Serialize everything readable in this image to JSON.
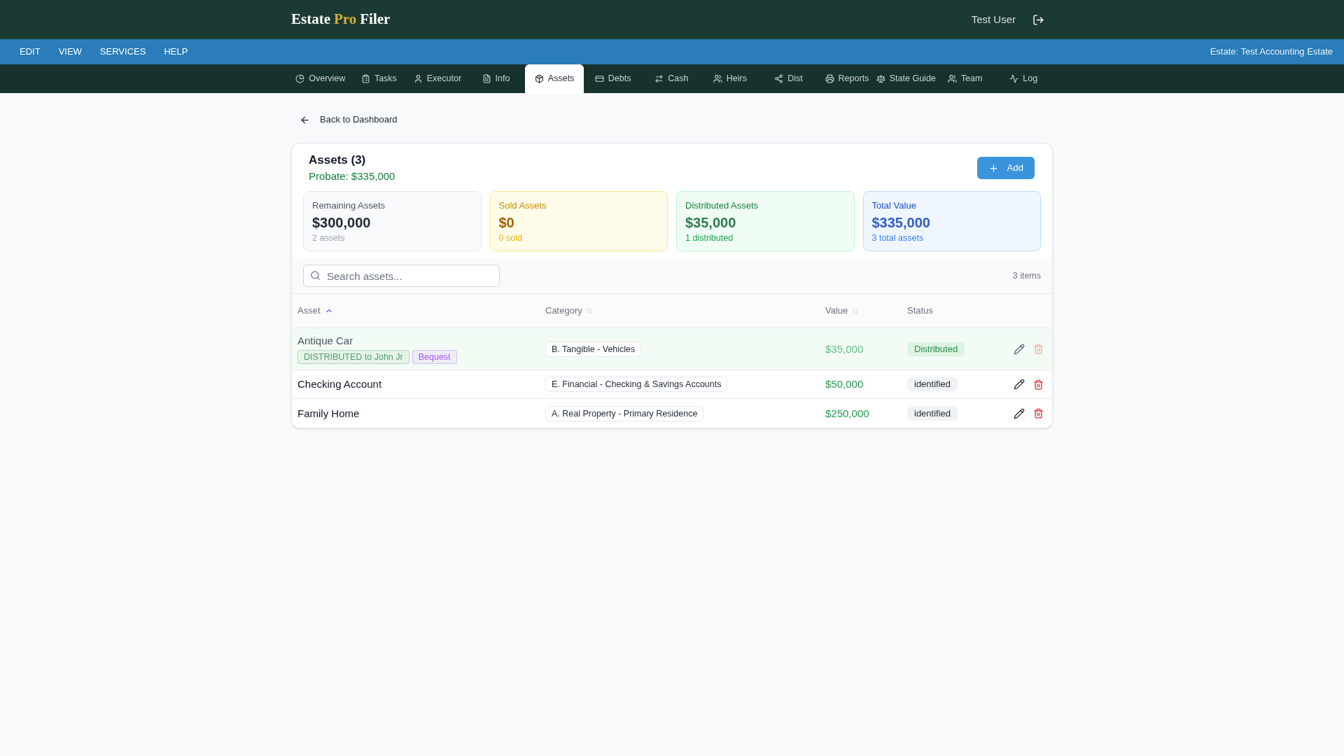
{
  "header": {
    "logo": [
      {
        "text": "Estate",
        "accent": false
      },
      {
        "text": "Pro",
        "accent": true
      },
      {
        "text": "Filer",
        "accent": false
      }
    ],
    "user": "Test User"
  },
  "menu_bar": {
    "items": [
      "EDIT",
      "VIEW",
      "SERVICES",
      "HELP"
    ],
    "estate": "Estate: Test Accounting Estate"
  },
  "tabs": [
    {
      "label": "Overview",
      "selected": false
    },
    {
      "label": "Tasks",
      "selected": false
    },
    {
      "label": "Executor",
      "selected": false
    },
    {
      "label": "Info",
      "selected": false
    },
    {
      "label": "Assets",
      "selected": true
    },
    {
      "label": "Debts",
      "selected": false
    },
    {
      "label": "Cash",
      "selected": false
    },
    {
      "label": "Heirs",
      "selected": false
    },
    {
      "label": "Dist",
      "selected": false
    },
    {
      "label": "Reports",
      "selected": false
    },
    {
      "label": "State Guide",
      "selected": false
    },
    {
      "label": "Team",
      "selected": false
    },
    {
      "label": "Log",
      "selected": false
    }
  ],
  "back_link": "Back to Dashboard",
  "assets_panel": {
    "title": "Assets (3)",
    "probate": "Probate: $335,000",
    "add_button": "Add",
    "stats": [
      {
        "kind": "neutral",
        "label": "Remaining Assets",
        "value": "$300,000",
        "note": "2 assets"
      },
      {
        "kind": "warning",
        "label": "Sold Assets",
        "value": "$0",
        "note": "0 sold"
      },
      {
        "kind": "success",
        "label": "Distributed Assets",
        "value": "$35,000",
        "note": "1 distributed"
      },
      {
        "kind": "info",
        "label": "Total Value",
        "value": "$335,000",
        "note": "3 total assets"
      }
    ],
    "search": {
      "placeholder": "Search assets..."
    },
    "item_count": "3 items",
    "table": {
      "columns": [
        {
          "label": "Asset",
          "sorted": true
        },
        {
          "label": "Category",
          "sorted": false
        },
        {
          "label": "Value",
          "sorted": false
        },
        {
          "label": "Status"
        }
      ],
      "rows": [
        {
          "asset": "Antique Car",
          "distributed": true,
          "tags": [
            {
              "label": "DISTRIBUTED to John Jr",
              "color": "#4f9e68"
            },
            {
              "label": "Bequest",
              "color": "#a855f7"
            }
          ],
          "category": "B. Tangible - Vehicles",
          "value": "$35,000",
          "status": {
            "label": "Distributed",
            "kind": "distributed"
          }
        },
        {
          "asset": "Checking Account",
          "distributed": false,
          "category": "E. Financial - Checking & Savings Accounts",
          "value": "$50,000",
          "status": {
            "label": "identified",
            "kind": "identified"
          }
        },
        {
          "asset": "Family Home",
          "distributed": false,
          "category": "A. Real Property - Primary Residence",
          "value": "$250,000",
          "status": {
            "label": "identified",
            "kind": "identified"
          }
        }
      ]
    }
  }
}
